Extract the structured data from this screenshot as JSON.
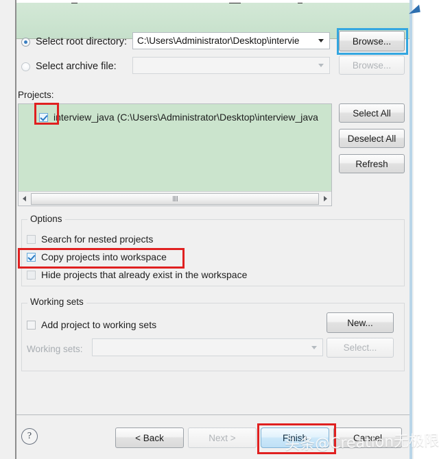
{
  "window": {
    "banner_present": true,
    "banner_color": "#cce4d0"
  },
  "source": {
    "root_radio_label": "Select root directory:",
    "root_value": "C:\\Users\\Administrator\\Desktop\\intervie",
    "root_selected": true,
    "root_browse_label": "Browse...",
    "archive_radio_label": "Select archive file:",
    "archive_value": "",
    "archive_selected": false,
    "archive_browse_label": "Browse..."
  },
  "projects": {
    "section_label": "Projects:",
    "items": [
      {
        "label": "interview_java (C:\\Users\\Administrator\\Desktop\\interview_java",
        "checked": true
      }
    ],
    "select_all_label": "Select All",
    "deselect_all_label": "Deselect All",
    "refresh_label": "Refresh"
  },
  "options": {
    "title": "Options",
    "items": [
      {
        "label": "Search for nested projects",
        "checked": false,
        "enabled": false
      },
      {
        "label": "Copy projects into workspace",
        "checked": true,
        "enabled": true
      },
      {
        "label": "Hide projects that already exist in the workspace",
        "checked": false,
        "enabled": false
      }
    ]
  },
  "working_sets": {
    "title": "Working sets",
    "add_label": "Add project to working sets",
    "add_checked": false,
    "new_label": "New...",
    "sets_label": "Working sets:",
    "sets_value": "",
    "select_label": "Select..."
  },
  "footer": {
    "help_glyph": "?",
    "back_label": "< Back",
    "next_label": "Next >",
    "finish_label": "Finish",
    "cancel_label": "Cancel",
    "back_enabled": true,
    "next_enabled": false
  },
  "watermark": {
    "text": "头条@Creation无极限"
  },
  "annotations": {
    "colors": {
      "red": "#e02020",
      "blue": "#33a6e0"
    }
  }
}
